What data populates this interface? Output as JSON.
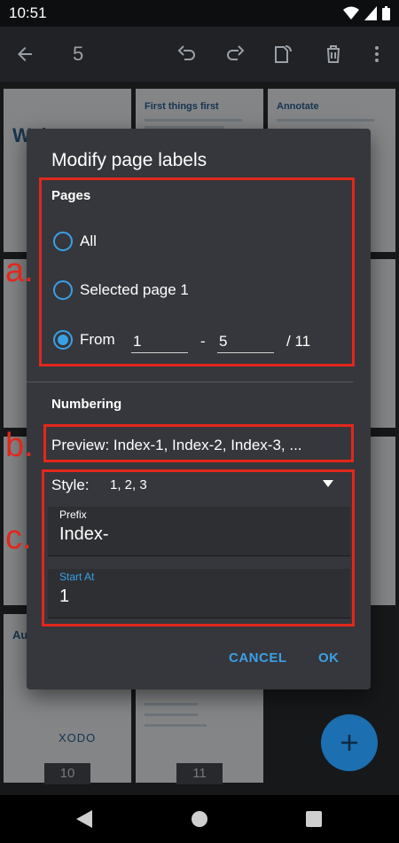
{
  "status_bar": {
    "time": "10:51"
  },
  "app_bar": {
    "page_count": "5"
  },
  "thumbnails": {
    "titles": [
      "Wel",
      "First things first",
      "Annotate",
      "Aut… wit",
      ""
    ],
    "page_numbers": [
      "10",
      "11"
    ],
    "brand": "XODO"
  },
  "dialog": {
    "title": "Modify page labels",
    "pages": {
      "label": "Pages",
      "option_all": "All",
      "option_selected": "Selected page 1",
      "option_from": "From",
      "from_value": "1",
      "dash": "-",
      "to_value": "5",
      "total": "/ 11",
      "selected_option": "From"
    },
    "numbering": {
      "label": "Numbering",
      "preview": "Preview: Index-1, Index-2, Index-3, ...",
      "style_label": "Style:",
      "style_value": "1, 2, 3",
      "prefix_label": "Prefix",
      "prefix_value": "Index-",
      "start_label": "Start At",
      "start_value": "1"
    },
    "cancel_label": "CANCEL",
    "ok_label": "OK"
  },
  "annotations": [
    "a.",
    "b.",
    "c."
  ],
  "colors": {
    "accent": "#3aa0e6",
    "annotation_red": "#e3271c",
    "dialog_bg": "#35373c",
    "fab": "#1c6fb0"
  }
}
